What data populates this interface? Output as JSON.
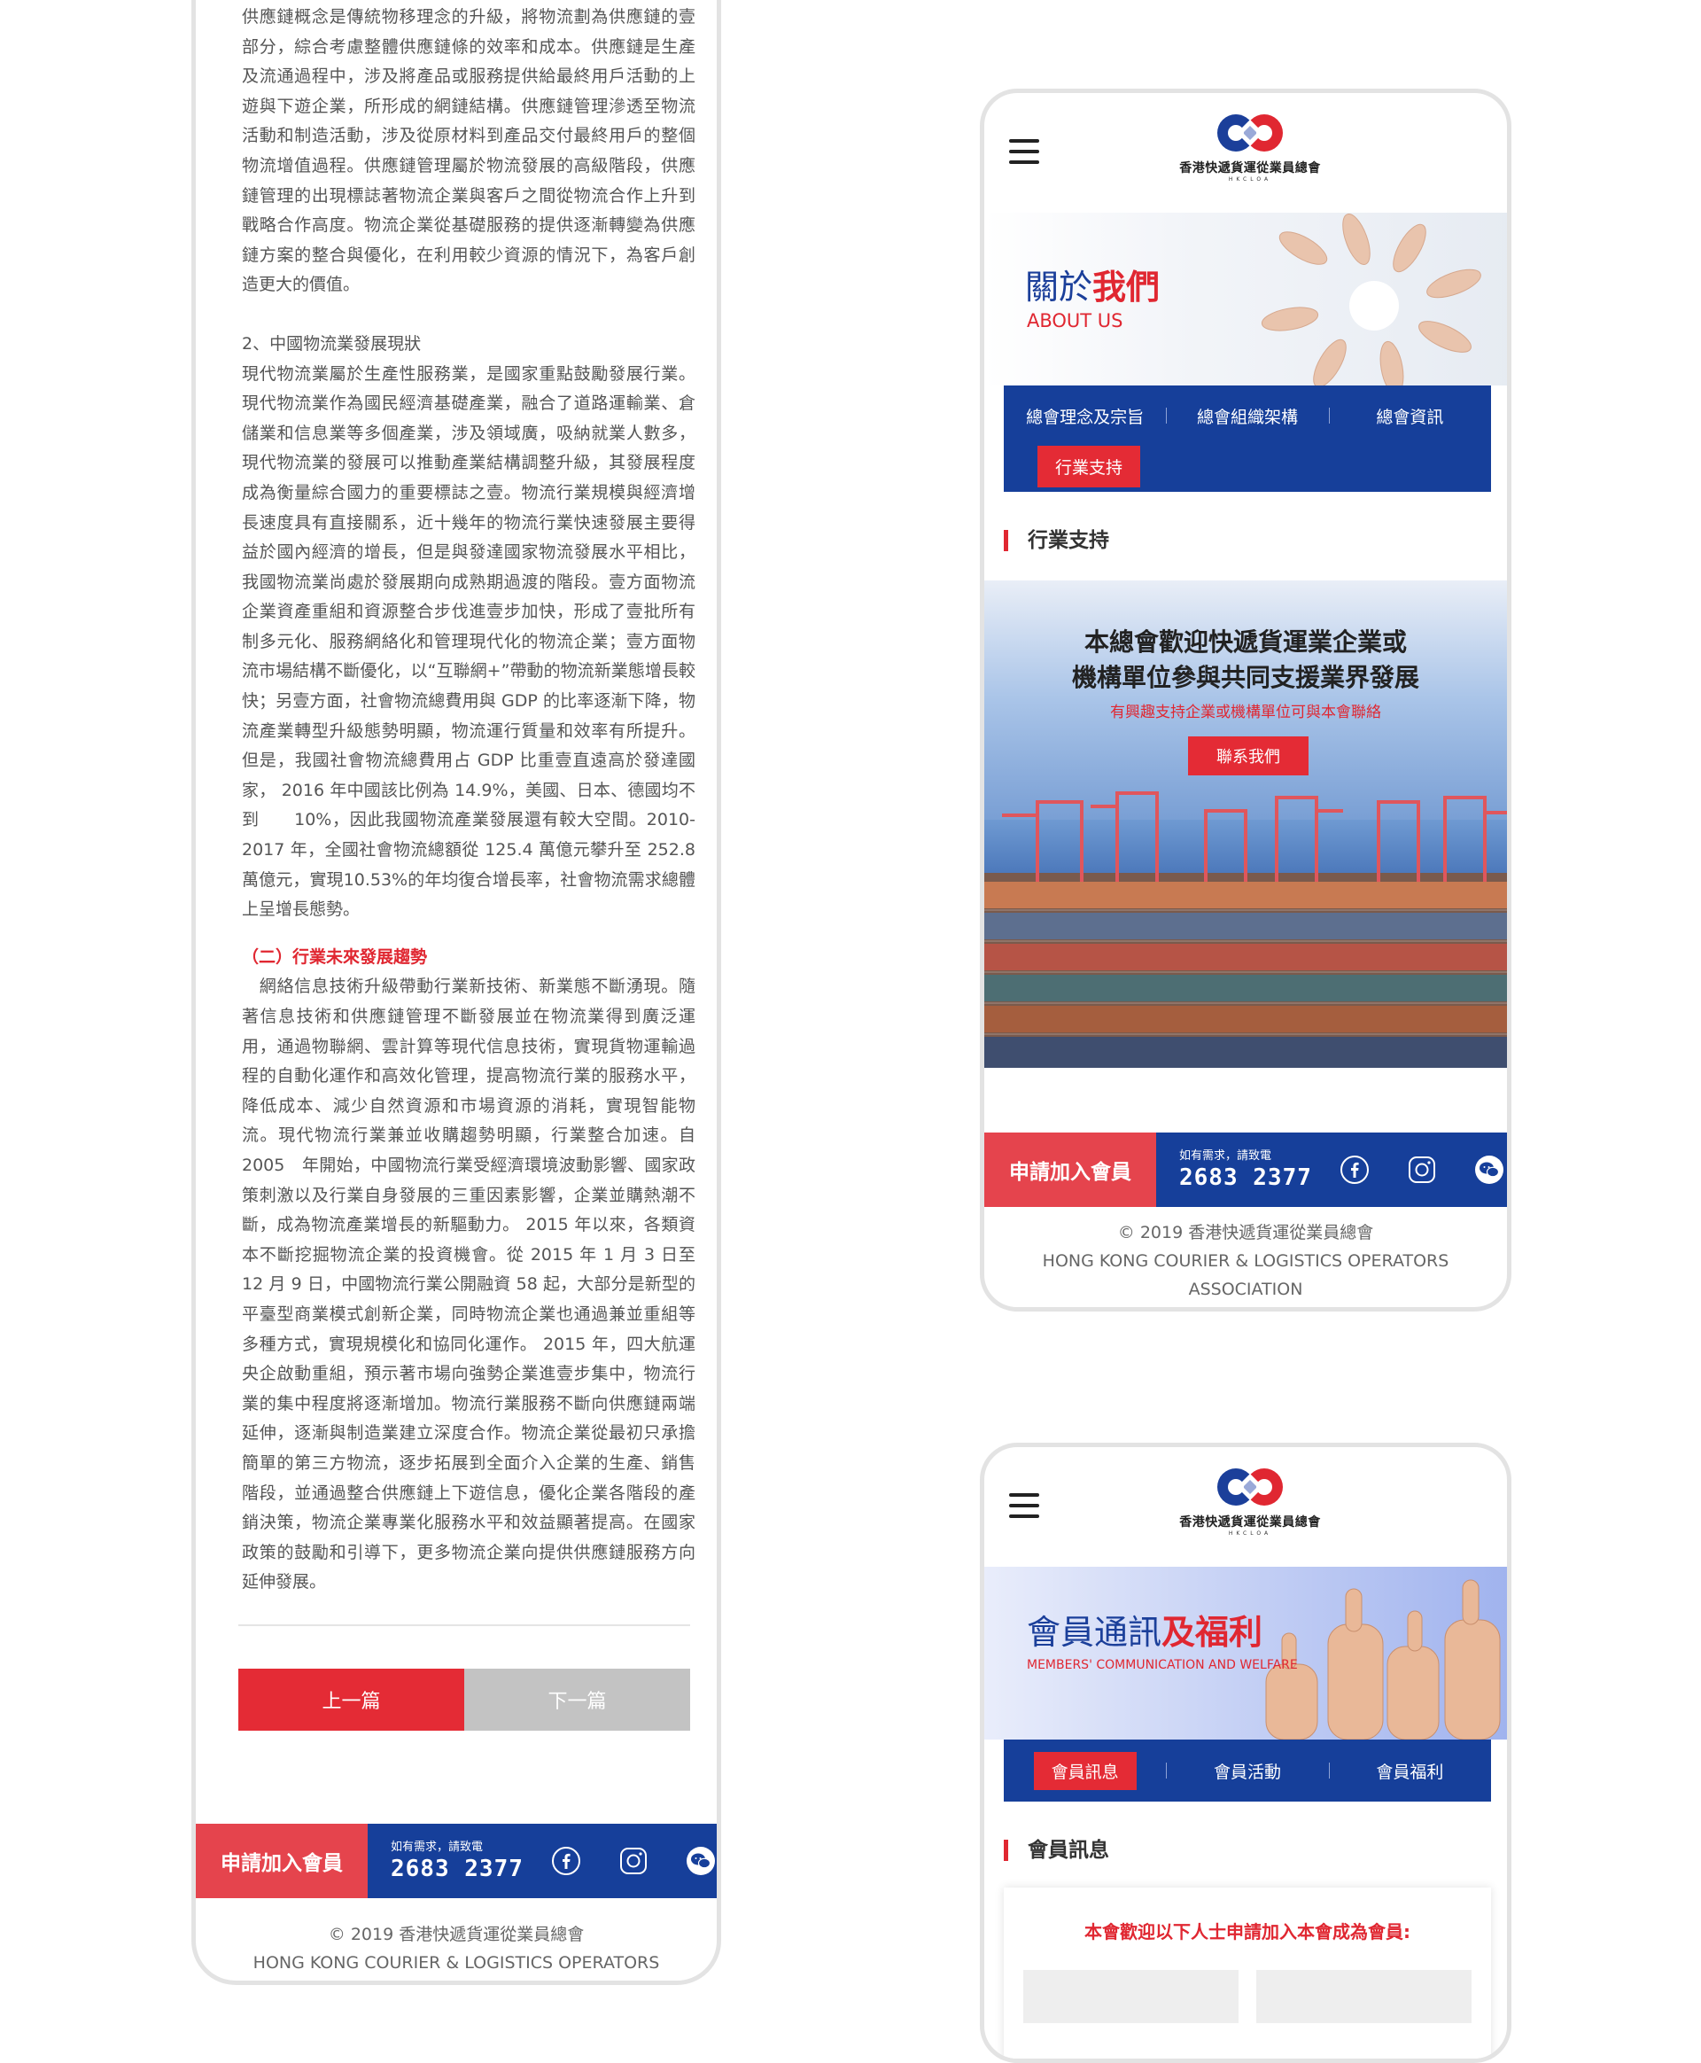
{
  "article": {
    "paragraphs": [
      "供應鏈概念是傳統物移理念的升級，將物流劃為供應鏈的壹部分，綜合考慮整體供應鏈條的效率和成本。供應鏈是生產及流通過程中，涉及將產品或服務提供給最終用戶活動的上遊與下遊企業，所形成的網鏈結構。供應鏈管理滲透至物流活動和制造活動，涉及從原材料到產品交付最終用戶的整個物流增值過程。供應鏈管理屬於物流發展的高級階段，供應鏈管理的出現標誌著物流企業與客戶之間從物流合作上升到戰略合作高度。物流企業從基礎服務的提供逐漸轉變為供應鏈方案的整合與優化，在利用較少資源的情況下，為客戶創造更大的價值。",
      "2、中國物流業發展現狀",
      "現代物流業屬於生產性服務業，是國家重點鼓勵發展行業。現代物流業作為國民經濟基礎產業，融合了道路運輸業、倉儲業和信息業等多個產業，涉及領域廣，吸納就業人數多，現代物流業的發展可以推動產業結構調整升級，其發展程度成為衡量綜合國力的重要標誌之壹。物流行業規模與經濟增長速度具有直接關系，近十幾年的物流行業快速發展主要得益於國內經濟的增長，但是與發達國家物流發展水平相比，我國物流業尚處於發展期向成熟期過渡的階段。壹方面物流企業資產重組和資源整合步伐進壹步加快，形成了壹批所有制多元化、服務網絡化和管理現代化的物流企業；壹方面物流市場結構不斷優化，以“互聯網+”帶動的物流新業態增長較快；另壹方面，社會物流總費用與 GDP 的比率逐漸下降，物流產業轉型升級態勢明顯，物流運行質量和效率有所提升。但是，我國社會物流總費用占 GDP 比重壹直遠高於發達國家， 2016 年中國該比例為 14.9%，美國、日本、德國均不到　　10%，因此我國物流產業發展還有較大空間。2010-2017 年，全國社會物流總額從 125.4 萬億元攀升至 252.8 萬億元，實現10.53%的年均復合增長率，社會物流需求總體上呈增長態勢。",
      "（二）行業未來發展趨勢",
      "　網絡信息技術升級帶動行業新技術、新業態不斷湧現。隨著信息技術和供應鏈管理不斷發展並在物流業得到廣泛運用，通過物聯網、雲計算等現代信息技術，實現貨物運輸過程的自動化運作和高效化管理，提高物流行業的服務水平，降低成本、減少自然資源和市場資源的消耗，實現智能物流。現代物流行業兼並收購趨勢明顯，行業整合加速。自 2005　年開始，中國物流行業受經濟環境波動影響、國家政策刺激以及行業自身發展的三重因素影響，企業並購熱潮不斷，成為物流產業增長的新驅動力。 2015 年以來，各類資本不斷挖掘物流企業的投資機會。從 2015 年 1 月 3 日至 12 月 9 日，中國物流行業公開融資 58 起，大部分是新型的平臺型商業模式創新企業，同時物流企業也通過兼並重組等多種方式，實現規模化和協同化運作。 2015 年，四大航運央企啟動重組，預示著市場向強勢企業進壹步集中，物流行業的集中程度將逐漸增加。物流行業服務不斷向供應鏈兩端延伸，逐漸與制造業建立深度合作。物流企業從最初只承擔簡單的第三方物流，逐步拓展到全面介入企業的生產、銷售階段，並通過整合供應鏈上下遊信息，優化企業各階段的產銷決策，物流企業專業化服務水平和效益顯著提高。在國家政策的鼓勵和引導下，更多物流企業向提供供應鏈服務方向延伸發展。"
    ],
    "prev_label": "上一篇",
    "next_label": "下一篇"
  },
  "contact": {
    "join_label": "申請加入會員",
    "tel_caption": "如有需求，請致電",
    "tel_number": "2683 2377",
    "social_icons": [
      "facebook-icon",
      "instagram-icon",
      "wechat-icon"
    ]
  },
  "footer": {
    "copyright": "© 2019 香港快遞貨運從業員總會",
    "name_en": "HONG KONG COURIER & LOGISTICS OPERATORS ASSOCIATION"
  },
  "logo": {
    "name_zh": "香港快遞貨運從業員總會",
    "abbr": "HKCLOA"
  },
  "about_page": {
    "banner_title_plain": "關於",
    "banner_title_bold": "我們",
    "banner_subtitle": "ABOUT US",
    "nav_items": [
      "總會理念及宗旨",
      "總會組織架構",
      "總會資訊"
    ],
    "nav_active": "行業支持",
    "section_title": "行業支持",
    "promo_heading_line1": "本總會歡迎快遞貨運業企業或",
    "promo_heading_line2": "機構單位參與共同支援業界發展",
    "promo_subtext": "有興趣支持企業或機構單位可與本會聯絡",
    "promo_button": "聯系我們"
  },
  "member_page": {
    "banner_title_plain": "會員通訊",
    "banner_title_bold": "及福利",
    "banner_subtitle": "MEMBERS' COMMUNICATION AND WELFARE",
    "nav_active": "會員訊息",
    "nav_items": [
      "會員活動",
      "會員福利"
    ],
    "section_title": "會員訊息",
    "card_lead": "本會歡迎以下人士申請加入本會成為會員:"
  },
  "colors": {
    "brand_blue": "#163f9a",
    "brand_red": "#e42b35",
    "join_red": "#e5444d"
  }
}
